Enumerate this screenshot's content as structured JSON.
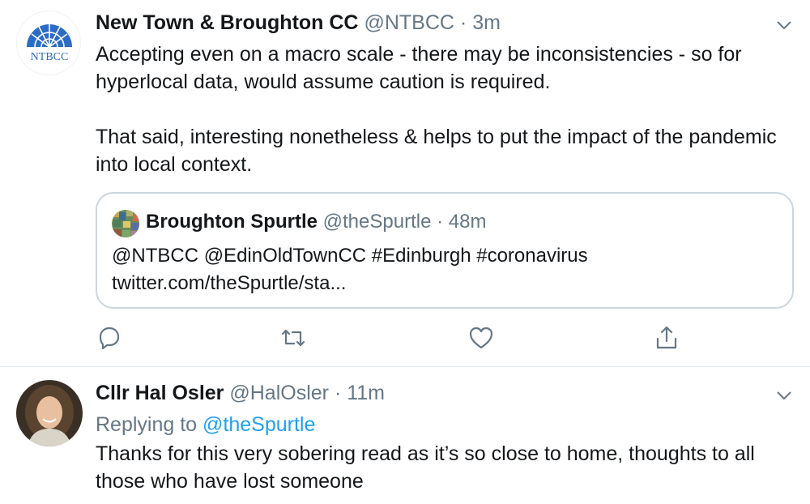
{
  "tweets": [
    {
      "name": "New Town & Broughton CC",
      "handle": "@NTBCC",
      "separator": "·",
      "time": "3m",
      "avatar_text": "NTBCC",
      "text": "Accepting even on a macro scale - there may be inconsistencies - so for hyperlocal data, would assume caution is required.\n\nThat said, interesting nonetheless & helps to put the impact of the pandemic into local context.",
      "quote": {
        "name": "Broughton Spurtle",
        "handle": "@theSpurtle",
        "separator": "·",
        "time": "48m",
        "line1": "@NTBCC @EdinOldTownCC #Edinburgh #coronavirus",
        "line2": "twitter.com/theSpurtle/sta..."
      },
      "actions": [
        "reply-icon",
        "retweet-icon",
        "like-icon",
        "share-icon"
      ]
    },
    {
      "name": "Cllr Hal Osler",
      "handle": "@HalOsler",
      "separator": "·",
      "time": "11m",
      "replying_label": "Replying to",
      "replying_to": "@theSpurtle",
      "text": "Thanks for this very sobering read as it’s so close to home, thoughts to all those who have lost someone"
    }
  ],
  "colors": {
    "accent": "#1da1f2",
    "secondary": "#657786",
    "avatar_blue": "#2b6cc4"
  }
}
